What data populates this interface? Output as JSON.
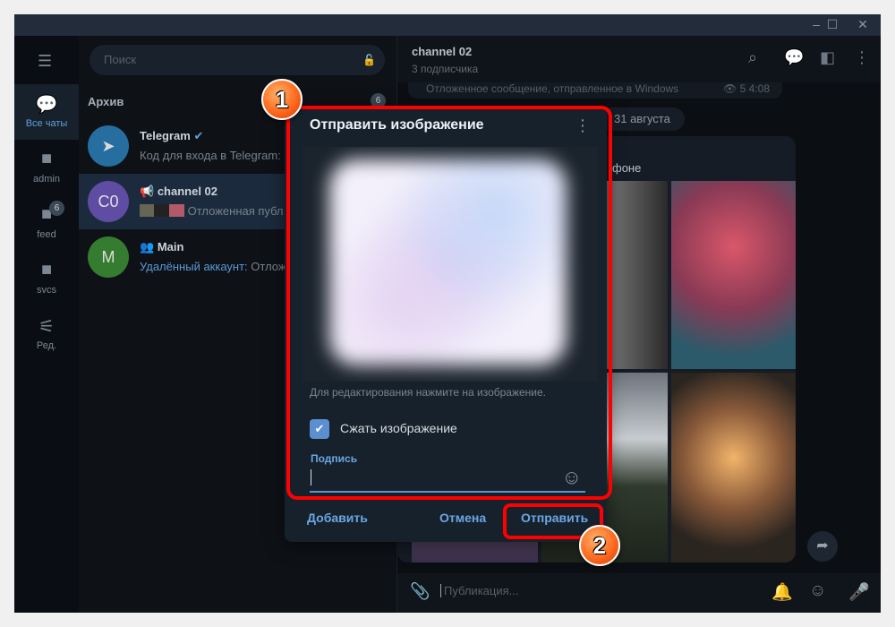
{
  "window": {
    "controls": [
      "minimize",
      "maximize",
      "close"
    ]
  },
  "rail": {
    "menu_icon": "menu-icon",
    "folders": [
      {
        "label": "Все чаты",
        "icon": "chats-icon",
        "active": true
      },
      {
        "label": "admin",
        "icon": "folder-icon"
      },
      {
        "label": "feed",
        "icon": "folder-icon",
        "badge": "6"
      },
      {
        "label": "svcs",
        "icon": "folder-icon"
      },
      {
        "label": "Ред.",
        "icon": "sliders-icon"
      }
    ]
  },
  "list": {
    "search_placeholder": "Поиск",
    "archive_label": "Архив",
    "archive_count": "6",
    "chats": [
      {
        "name": "Telegram",
        "preview": "Код для входа в Telegram: ",
        "avatar": "",
        "color": "#2a7fb8",
        "verified": true
      },
      {
        "name": "channel 02",
        "preview": "Отложенная публ",
        "avatar": "C0",
        "color": "#6b54b5",
        "selected": true
      },
      {
        "name": "Main",
        "preview_sender": "Удалённый аккаунт:",
        "preview": " Отлож",
        "avatar": "M",
        "color": "#3e8f35"
      }
    ]
  },
  "chat": {
    "title": "channel 02",
    "subtitle": "3 подписчика",
    "prev_message": "Отложенное сообщение, отправленное в Windows",
    "prev_views": "5",
    "prev_time": "4:08",
    "date_pill": "31 августа",
    "bubble_text": "фоне",
    "input_placeholder": "Публикация..."
  },
  "dialog": {
    "title": "Отправить изображение",
    "hint": "Для редактирования нажмите на изображение.",
    "compress_label": "Сжать изображение",
    "compress_checked": true,
    "caption_label": "Подпись",
    "caption_value": "",
    "add_button": "Добавить",
    "cancel_button": "Отмена",
    "send_button": "Отправить"
  },
  "annotations": {
    "step1": "1",
    "step2": "2",
    "highlight_color": "#ff0000"
  }
}
